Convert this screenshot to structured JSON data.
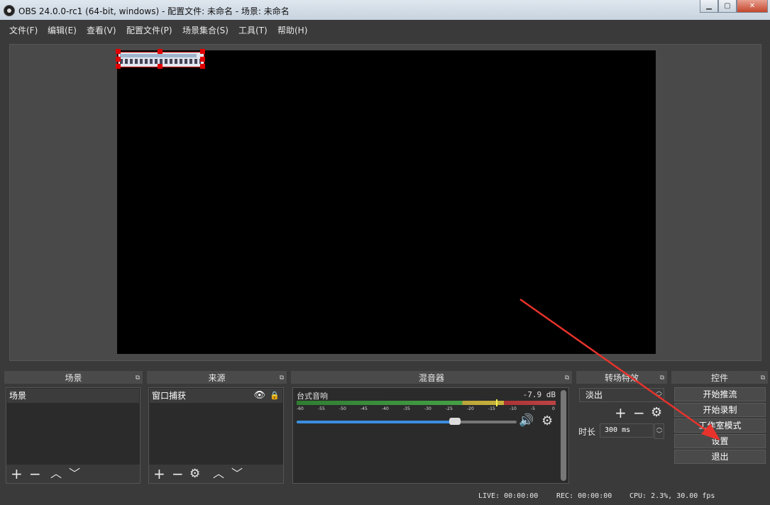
{
  "window": {
    "title": "OBS 24.0.0-rc1 (64-bit, windows) - 配置文件: 未命名 - 场景: 未命名"
  },
  "menu": [
    "文件(F)",
    "编辑(E)",
    "查看(V)",
    "配置文件(P)",
    "场景集合(S)",
    "工具(T)",
    "帮助(H)"
  ],
  "docks": {
    "scenes": {
      "title": "场景",
      "items": [
        "场景"
      ]
    },
    "sources": {
      "title": "来源",
      "items": [
        "窗口捕获"
      ]
    },
    "mixer": {
      "title": "混音器",
      "channel": "台式音响",
      "db": "-7.9 dB",
      "ticks": [
        "-60",
        "-55",
        "-50",
        "-45",
        "-40",
        "-35",
        "-30",
        "-25",
        "-20",
        "-15",
        "-10",
        "-5",
        "0"
      ],
      "volume_fraction": 0.72
    },
    "transitions": {
      "title": "转场特效",
      "selected": "淡出",
      "duration_label": "时长",
      "duration_value": "300 ms"
    },
    "controls": {
      "title": "控件",
      "buttons": [
        "开始推流",
        "开始录制",
        "工作室模式",
        "设置",
        "退出"
      ]
    }
  },
  "status": {
    "live": "LIVE: 00:00:00",
    "rec": "REC: 00:00:00",
    "cpu": "CPU: 2.3%, 30.00 fps"
  },
  "colors": {
    "accent": "#3b8ee0",
    "annotation": "#e8332c"
  }
}
